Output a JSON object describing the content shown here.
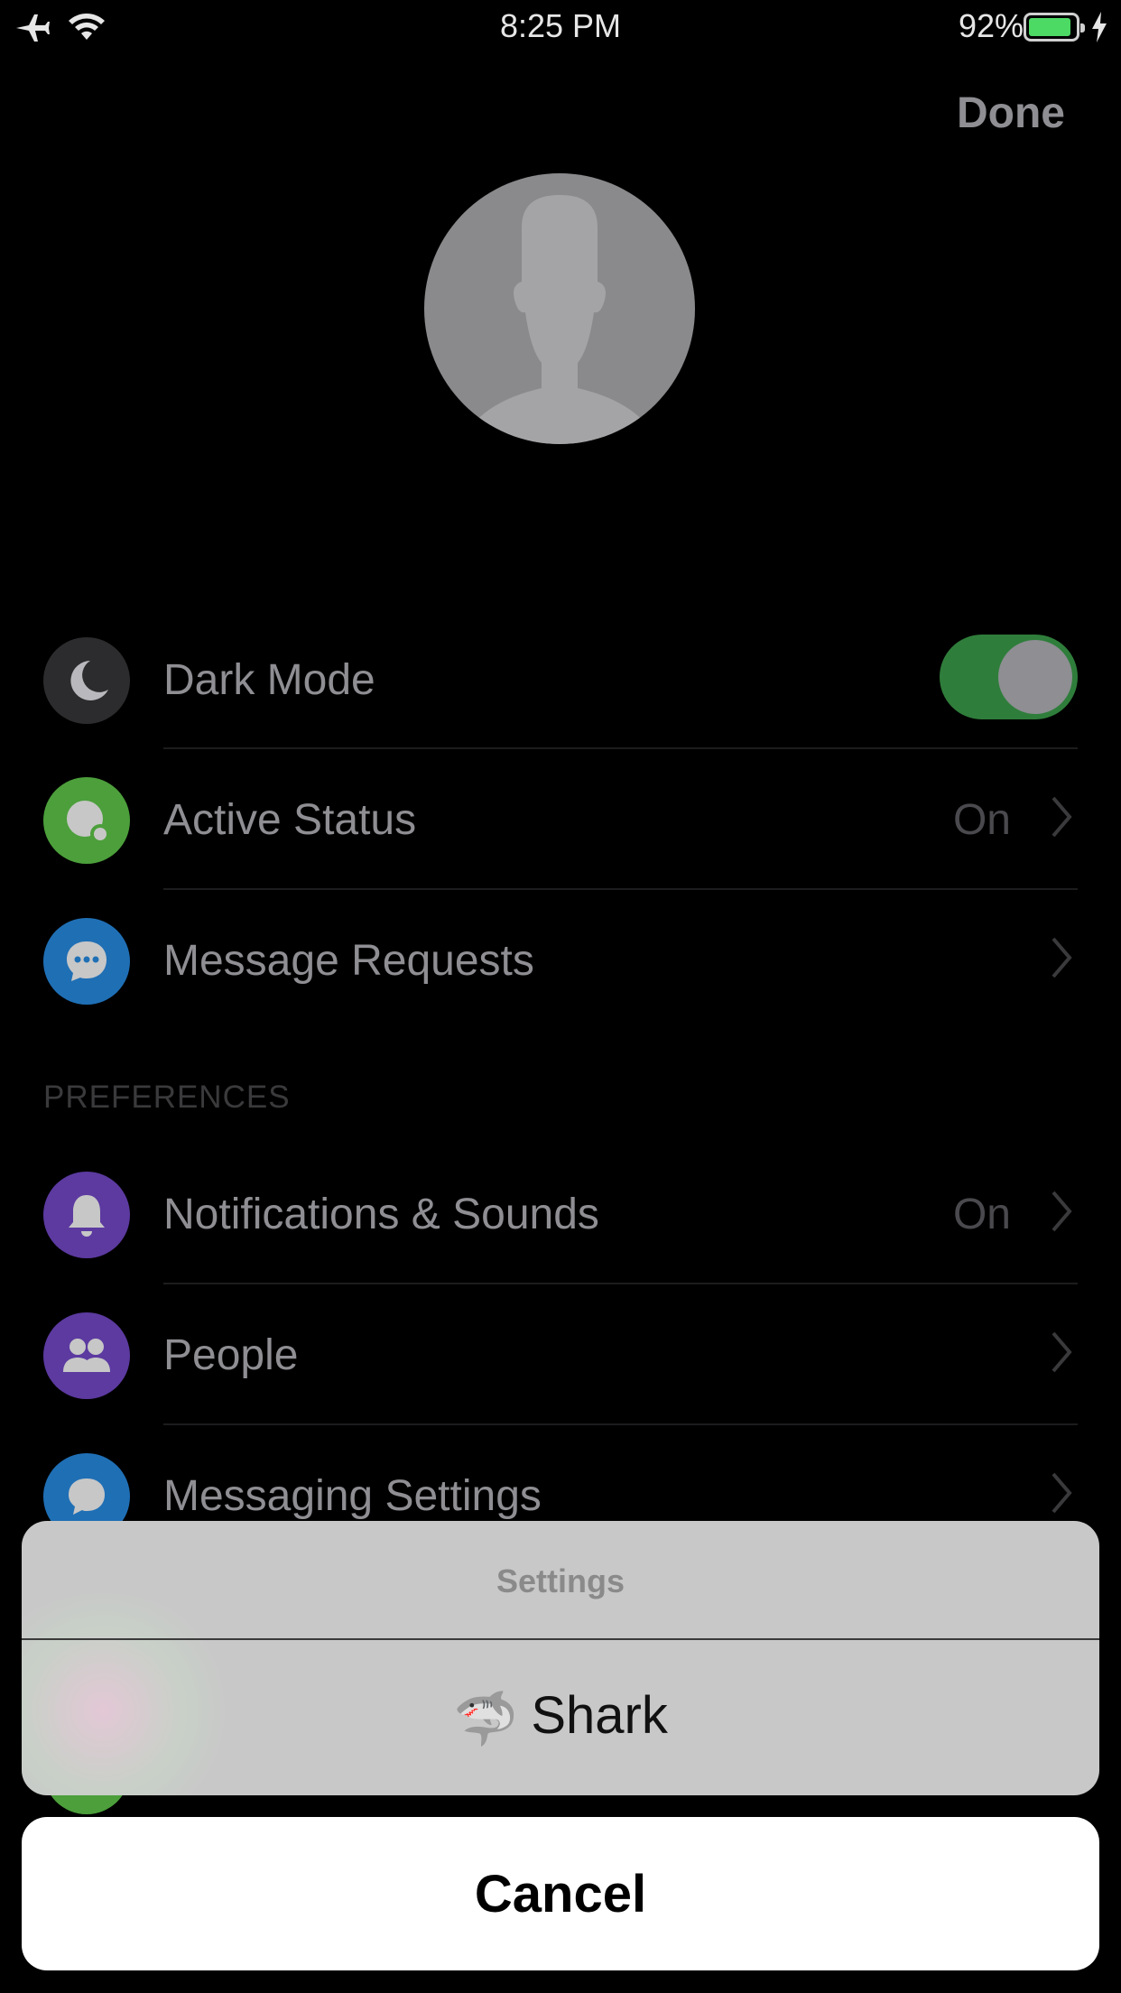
{
  "status_bar": {
    "time": "8:25 PM",
    "battery_percent": "92%",
    "battery_level": 0.92,
    "airplane_mode": true,
    "wifi": true,
    "charging": true
  },
  "header": {
    "done_label": "Done"
  },
  "profile": {
    "avatar_icon": "default-person-silhouette"
  },
  "rows": [
    {
      "label": "Dark Mode",
      "icon": "moon-icon",
      "icon_bg": "#2c2c2e",
      "toggle": true
    },
    {
      "label": "Active Status",
      "icon": "active-status-icon",
      "icon_bg": "#4c9f3b",
      "value": "On"
    },
    {
      "label": "Message Requests",
      "icon": "chat-bubble-icon",
      "icon_bg": "#1f6fb5"
    }
  ],
  "preferences": {
    "section_title": "PREFERENCES",
    "rows": [
      {
        "label": "Notifications & Sounds",
        "icon": "bell-icon",
        "icon_bg": "#5c3aa0",
        "value": "On"
      },
      {
        "label": "People",
        "icon": "people-icon",
        "icon_bg": "#5c3aa0"
      },
      {
        "label": "Messaging Settings",
        "icon": "message-icon",
        "icon_bg": "#1f6fb5"
      }
    ]
  },
  "action_sheet": {
    "title": "Settings",
    "option_emoji": "🦈",
    "option_label": "Shark",
    "cancel_label": "Cancel"
  },
  "colors": {
    "background": "#000000",
    "toggle_on": "#2f7d3b",
    "sheet_bg": "#c8c8c8",
    "battery_fill": "#4cd964"
  }
}
